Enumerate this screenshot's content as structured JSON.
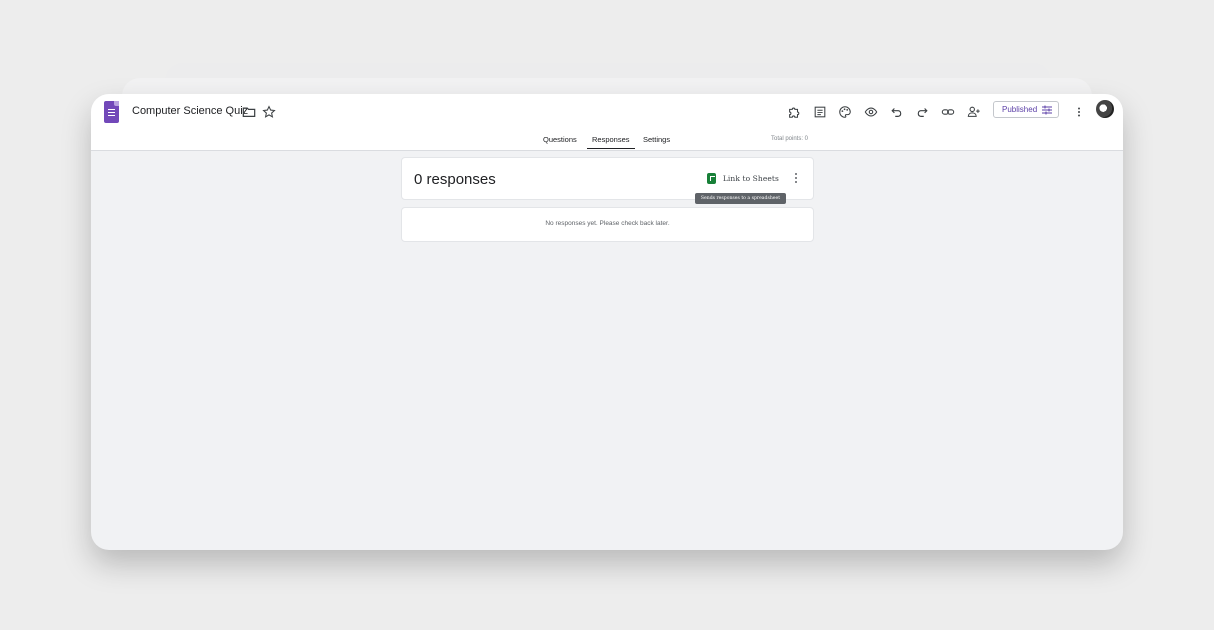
{
  "app": {
    "title": "Computer Science Quiz",
    "icons": {
      "logo": "google-forms-icon",
      "folder": "folder-icon",
      "star": "star-icon"
    }
  },
  "toolbar": {
    "icons": [
      "puzzle-icon",
      "notes-icon",
      "palette-icon",
      "preview-eye-icon",
      "undo-icon",
      "redo-icon",
      "link-icon",
      "add-person-icon"
    ],
    "published_label": "Published",
    "more_icon": "more-vert-icon",
    "avatar": "avatar"
  },
  "tabs": {
    "items": [
      "Questions",
      "Responses",
      "Settings"
    ],
    "active": "Responses",
    "total_points": "Total points: 0"
  },
  "responses": {
    "count_label": "0 responses",
    "link_sheets_label": "Link to Sheets",
    "tooltip": "Sends responses to a spreadsheet",
    "empty_message": "No responses yet. Please check back later."
  },
  "colors": {
    "accent": "#7248b9",
    "sheets_green": "#188038",
    "background": "#f1f2f4"
  }
}
